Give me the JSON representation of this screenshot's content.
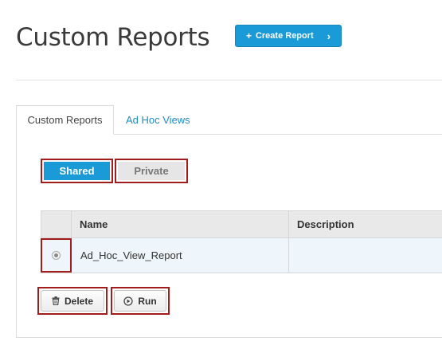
{
  "header": {
    "title": "Custom Reports",
    "create_button": {
      "plus": "+",
      "label": "Create Report",
      "chevron": "›"
    }
  },
  "tabs": [
    {
      "label": "Custom Reports",
      "active": true
    },
    {
      "label": "Ad Hoc Views",
      "active": false
    }
  ],
  "scope_toggle": {
    "shared_label": "Shared",
    "private_label": "Private",
    "selected": "Shared"
  },
  "table": {
    "columns": [
      "",
      "Name",
      "Description"
    ],
    "rows": [
      {
        "selected": true,
        "name": "Ad_Hoc_View_Report",
        "description": ""
      }
    ]
  },
  "actions": {
    "delete_label": "Delete",
    "delete_icon": "trash-icon",
    "run_label": "Run",
    "run_icon": "play-circle-icon"
  },
  "colors": {
    "accent": "#1a9ad6",
    "highlight_border": "#a31c1c",
    "link": "#1a8dc5",
    "row_selected_bg": "#eef5fb"
  }
}
